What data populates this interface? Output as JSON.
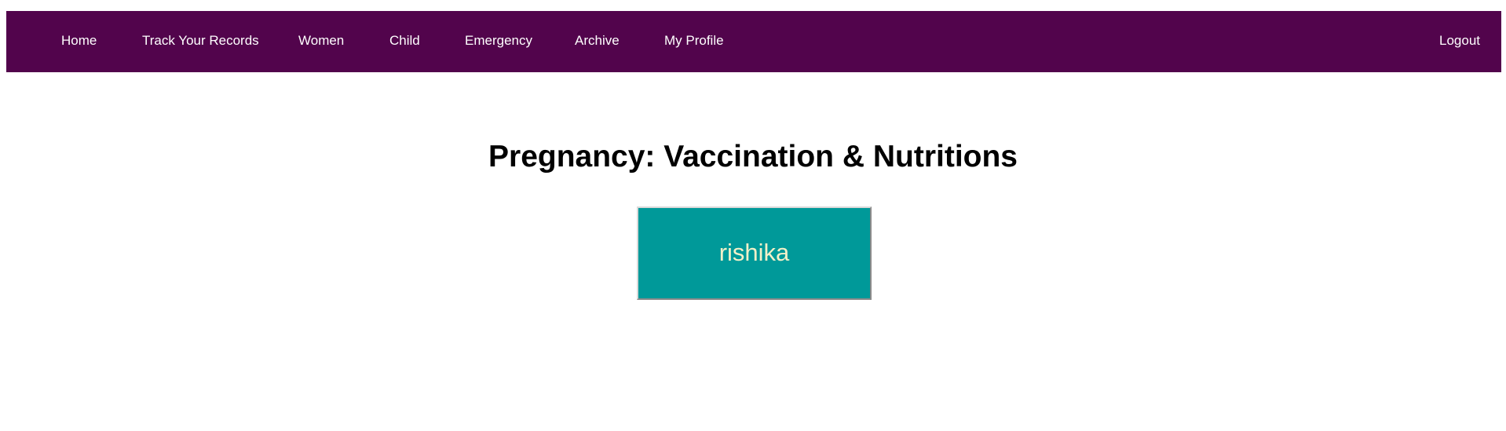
{
  "nav": {
    "items": [
      {
        "label": "Home"
      },
      {
        "label": "Track Your Records"
      },
      {
        "label": "Women"
      },
      {
        "label": "Child"
      },
      {
        "label": "Emergency"
      },
      {
        "label": "Archive"
      },
      {
        "label": "My Profile"
      }
    ],
    "logout_label": "Logout"
  },
  "main": {
    "title": "Pregnancy: Vaccination & Nutritions",
    "profile_button_label": "rishika"
  },
  "colors": {
    "navbar_background": "#52044c",
    "nav_text": "#ffffff",
    "button_background": "#009999",
    "button_text": "#f3f0c8"
  }
}
